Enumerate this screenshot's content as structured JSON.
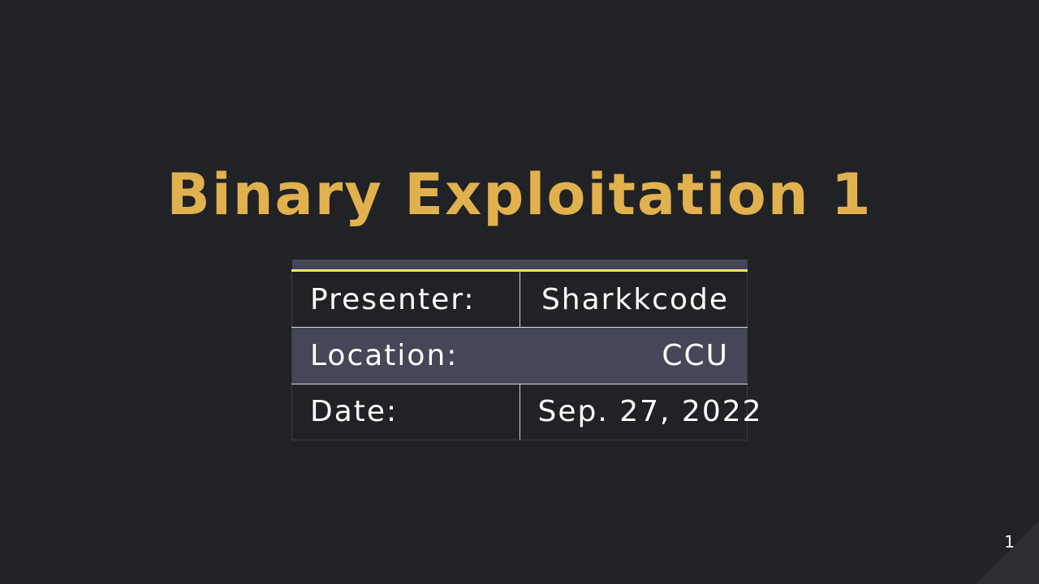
{
  "slide": {
    "title": "Binary Exploitation 1",
    "page_number": "1"
  },
  "info_table": {
    "rows": [
      {
        "label": "Presenter:",
        "value": "Sharkkcode"
      },
      {
        "label": "Location:",
        "value": "CCU"
      },
      {
        "label": "Date:",
        "value": "Sep. 27, 2022"
      }
    ]
  },
  "colors": {
    "background": "#212226",
    "title": "#E1B14E",
    "table_shade": "#444757",
    "header_rule": "#EDE46B",
    "text": "#FFFFFF"
  }
}
